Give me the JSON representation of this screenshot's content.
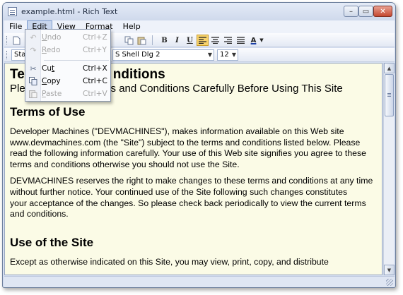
{
  "window": {
    "title": "example.html - Rich Text",
    "icon": "document-icon"
  },
  "title_buttons": {
    "minimize": "–",
    "maximize": "▭",
    "close": "✕"
  },
  "menubar": {
    "items": [
      "File",
      "Edit",
      "View",
      "Format",
      "Help"
    ],
    "active": "Edit"
  },
  "edit_menu": {
    "items": [
      {
        "label": "Undo",
        "mnemonic": "U",
        "rest": "ndo",
        "shortcut": "Ctrl+Z",
        "icon": "undo-icon",
        "enabled": false
      },
      {
        "label": "Redo",
        "mnemonic": "R",
        "rest": "edo",
        "shortcut": "Ctrl+Y",
        "icon": "redo-icon",
        "enabled": false
      },
      {
        "label": "Cut",
        "mnemonic": "t",
        "prefix": "Cu",
        "shortcut": "Ctrl+X",
        "icon": "cut-icon",
        "enabled": true
      },
      {
        "label": "Copy",
        "mnemonic": "C",
        "rest": "opy",
        "shortcut": "Ctrl+C",
        "icon": "copy-icon",
        "enabled": true
      },
      {
        "label": "Paste",
        "mnemonic": "P",
        "rest": "aste",
        "shortcut": "Ctrl+V",
        "icon": "paste-icon",
        "enabled": false
      }
    ]
  },
  "toolbar": {
    "bold": "B",
    "italic": "I",
    "underline": "U",
    "font_color": "A",
    "style_combo": "Star",
    "font_combo": "S Shell Dlg 2",
    "size_combo": "12",
    "align_left_checked": true
  },
  "document": {
    "heading_visible": "Te",
    "heading_visible_end": "nditions",
    "subtitle_visible": "Plea",
    "subtitle_visible_end": "rms and Conditions Carefully Before Using This Site",
    "sections": [
      {
        "heading": "Terms of Use",
        "paragraphs": [
          [
            "Developer Machines (\"DEVMACHINES\"), makes information available on this Web site",
            "www.devmachines.com (the \"Site\") subject to the terms and conditions listed below. Please",
            "read the following information carefully. Your use of this Web site signifies you agree to these",
            "terms and conditions otherwise you should not use the Site."
          ],
          [
            "DEVMACHINES reserves the right to make changes to these terms and conditions at any time",
            "without further notice. Your continued use of the Site following such changes constitutes",
            "your acceptance of the changes. So please check back periodically to view the current terms",
            "and conditions."
          ]
        ]
      },
      {
        "heading": "Use of the Site",
        "paragraphs": [
          [
            "Except as otherwise indicated on this Site, you may view, print, copy, and distribute"
          ]
        ]
      }
    ]
  },
  "colors": {
    "doc_background": "#fbfbe6",
    "menu_highlight": "#c9d7ee",
    "checked_button": "#f8d36c"
  }
}
